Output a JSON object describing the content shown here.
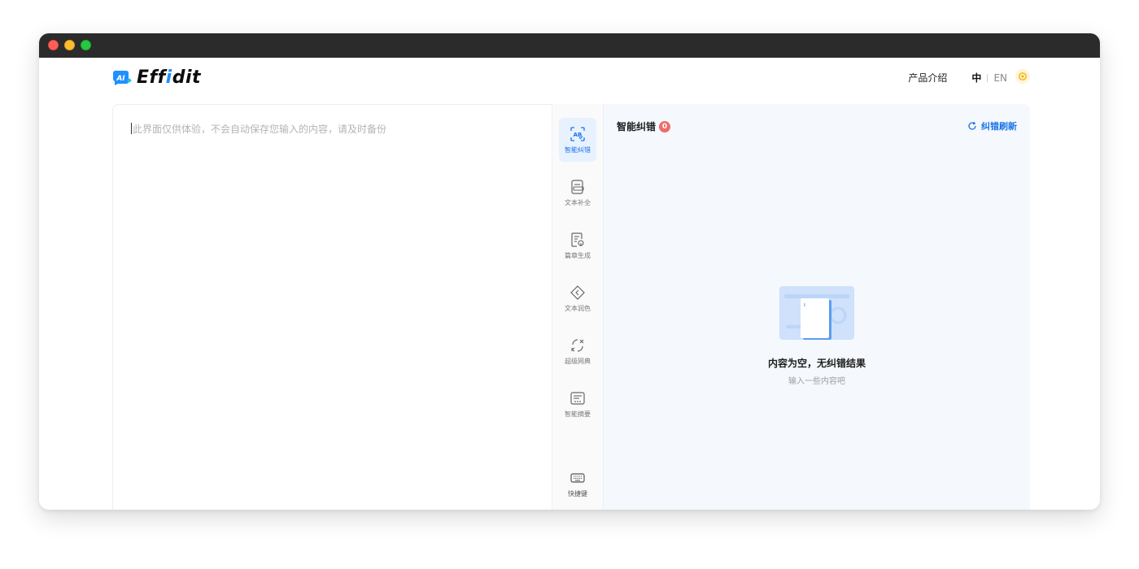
{
  "app": {
    "logo_text_a": "Eff",
    "logo_text_b": "i",
    "logo_text_c": "dit",
    "logo_mark_text": "AI",
    "brand_color": "#1e90ff"
  },
  "nav": {
    "intro_label": "产品介绍",
    "lang_zh": "中",
    "lang_en": "EN"
  },
  "editor": {
    "placeholder": "此界面仅供体验，不会自动保存您输入的内容，请及时备份"
  },
  "toolbar": {
    "items": [
      {
        "label": "智能纠错",
        "icon": "ai-check-icon",
        "active": true
      },
      {
        "label": "文本补全",
        "icon": "text-complete-icon",
        "active": false
      },
      {
        "label": "篇章生成",
        "icon": "article-generate-icon",
        "active": false
      },
      {
        "label": "文本润色",
        "icon": "polish-icon",
        "active": false
      },
      {
        "label": "超级网典",
        "icon": "dictionary-icon",
        "active": false
      },
      {
        "label": "智能摘要",
        "icon": "summary-icon",
        "active": false
      }
    ],
    "shortcut_label": "快捷键"
  },
  "panel": {
    "title": "智能纠错",
    "error_count": "0",
    "refresh_label": "纠错刷新",
    "empty_title": "内容为空，无纠错结果",
    "empty_sub": "输入一些内容吧"
  },
  "colors": {
    "accent": "#1a73e8",
    "badge": "#f06b6b",
    "panel_bg": "#f5f8fd"
  }
}
